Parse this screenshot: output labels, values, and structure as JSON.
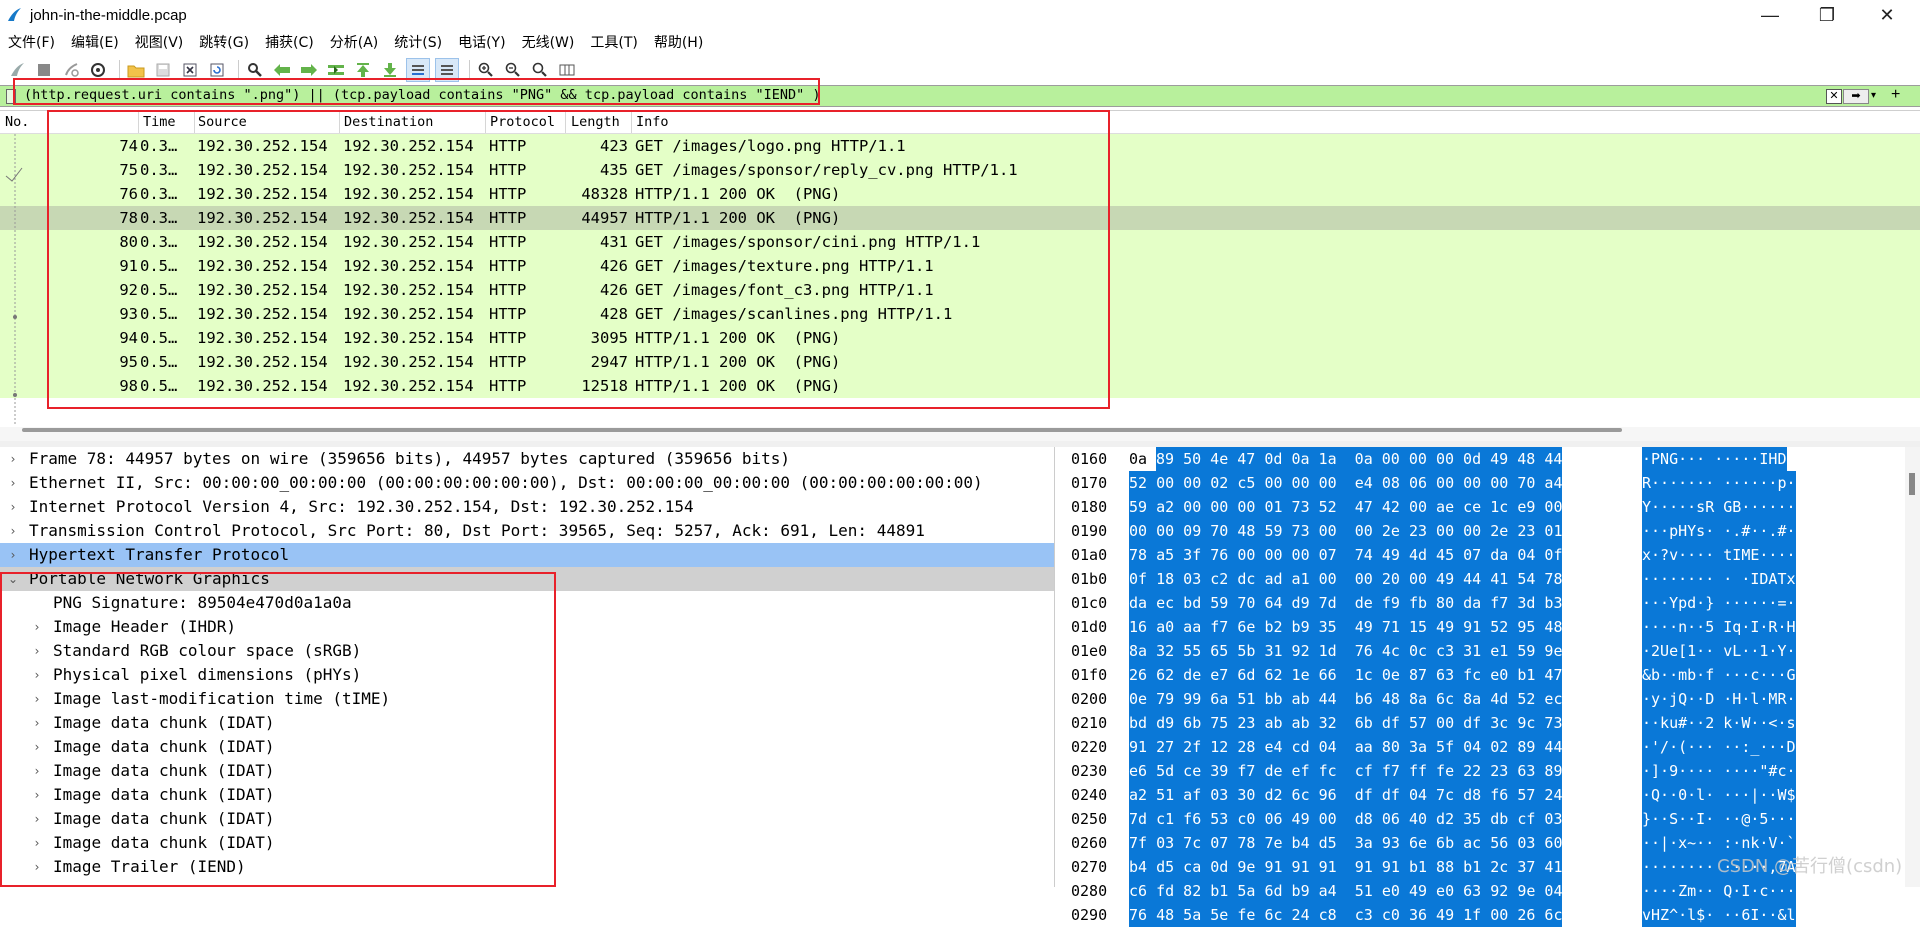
{
  "window": {
    "title": "john-in-the-middle.pcap",
    "minimize": "—",
    "maximize": "❐",
    "close": "✕"
  },
  "menu": [
    "文件(F)",
    "编辑(E)",
    "视图(V)",
    "跳转(G)",
    "捕获(C)",
    "分析(A)",
    "统计(S)",
    "电话(Y)",
    "无线(W)",
    "工具(T)",
    "帮助(H)"
  ],
  "toolbar_icons": [
    "shark-fin-start-icon",
    "stop-icon",
    "restart-icon",
    "capture-options-icon",
    "open-folder-icon",
    "save-icon",
    "close-file-icon",
    "reload-icon",
    "find-icon",
    "back-arrow-icon",
    "forward-arrow-icon",
    "goto-packet-icon",
    "first-packet-icon",
    "last-packet-icon",
    "autoscroll-icon",
    "colorize-icon",
    "zoom-in-icon",
    "zoom-out-icon",
    "zoom-normal-icon",
    "resize-columns-icon"
  ],
  "filter": {
    "text": "(http.request.uri contains \".png\") || (tcp.payload contains \"PNG\" && tcp.payload contains \"IEND\" )",
    "clear_label": "✕",
    "apply_label": "➡",
    "dropdown_label": "▾",
    "add_label": "+",
    "bg_color": "#b8f09c"
  },
  "packet_list": {
    "columns": [
      "No.",
      "Time",
      "Source",
      "Destination",
      "Protocol",
      "Length",
      "Info"
    ],
    "rows": [
      {
        "no": "74",
        "time": "0.3…",
        "src": "192.30.252.154",
        "dst": "192.30.252.154",
        "proto": "HTTP",
        "len": "423",
        "info": "GET /images/logo.png HTTP/1.1"
      },
      {
        "no": "75",
        "time": "0.3…",
        "src": "192.30.252.154",
        "dst": "192.30.252.154",
        "proto": "HTTP",
        "len": "435",
        "info": "GET /images/sponsor/reply_cv.png HTTP/1.1"
      },
      {
        "no": "76",
        "time": "0.3…",
        "src": "192.30.252.154",
        "dst": "192.30.252.154",
        "proto": "HTTP",
        "len": "48328",
        "info": "HTTP/1.1 200 OK  (PNG)"
      },
      {
        "no": "78",
        "time": "0.3…",
        "src": "192.30.252.154",
        "dst": "192.30.252.154",
        "proto": "HTTP",
        "len": "44957",
        "info": "HTTP/1.1 200 OK  (PNG)",
        "selected": true
      },
      {
        "no": "80",
        "time": "0.3…",
        "src": "192.30.252.154",
        "dst": "192.30.252.154",
        "proto": "HTTP",
        "len": "431",
        "info": "GET /images/sponsor/cini.png HTTP/1.1"
      },
      {
        "no": "91",
        "time": "0.5…",
        "src": "192.30.252.154",
        "dst": "192.30.252.154",
        "proto": "HTTP",
        "len": "426",
        "info": "GET /images/texture.png HTTP/1.1"
      },
      {
        "no": "92",
        "time": "0.5…",
        "src": "192.30.252.154",
        "dst": "192.30.252.154",
        "proto": "HTTP",
        "len": "426",
        "info": "GET /images/font_c3.png HTTP/1.1"
      },
      {
        "no": "93",
        "time": "0.5…",
        "src": "192.30.252.154",
        "dst": "192.30.252.154",
        "proto": "HTTP",
        "len": "428",
        "info": "GET /images/scanlines.png HTTP/1.1"
      },
      {
        "no": "94",
        "time": "0.5…",
        "src": "192.30.252.154",
        "dst": "192.30.252.154",
        "proto": "HTTP",
        "len": "3095",
        "info": "HTTP/1.1 200 OK  (PNG)"
      },
      {
        "no": "95",
        "time": "0.5…",
        "src": "192.30.252.154",
        "dst": "192.30.252.154",
        "proto": "HTTP",
        "len": "2947",
        "info": "HTTP/1.1 200 OK  (PNG)"
      },
      {
        "no": "98",
        "time": "0.5…",
        "src": "192.30.252.154",
        "dst": "192.30.252.154",
        "proto": "HTTP",
        "len": "12518",
        "info": "HTTP/1.1 200 OK  (PNG)"
      }
    ]
  },
  "detail": [
    {
      "text": "Frame 78: 44957 bytes on wire (359656 bits), 44957 bytes captured (359656 bits)",
      "level": 0,
      "arrow": "›",
      "style": ""
    },
    {
      "text": "Ethernet II, Src: 00:00:00_00:00:00 (00:00:00:00:00:00), Dst: 00:00:00_00:00:00 (00:00:00:00:00:00)",
      "level": 0,
      "arrow": "›",
      "style": ""
    },
    {
      "text": "Internet Protocol Version 4, Src: 192.30.252.154, Dst: 192.30.252.154",
      "level": 0,
      "arrow": "›",
      "style": ""
    },
    {
      "text": "Transmission Control Protocol, Src Port: 80, Dst Port: 39565, Seq: 5257, Ack: 691, Len: 44891",
      "level": 0,
      "arrow": "›",
      "style": ""
    },
    {
      "text": "Hypertext Transfer Protocol",
      "level": 0,
      "arrow": "›",
      "style": "hl"
    },
    {
      "text": "Portable Network Graphics",
      "level": 0,
      "arrow": "⌄",
      "style": "sel"
    },
    {
      "text": "PNG Signature: 89504e470d0a1a0a",
      "level": 1,
      "arrow": "",
      "style": ""
    },
    {
      "text": "Image Header (IHDR)",
      "level": 1,
      "arrow": "›",
      "style": ""
    },
    {
      "text": "Standard RGB colour space (sRGB)",
      "level": 1,
      "arrow": "›",
      "style": ""
    },
    {
      "text": "Physical pixel dimensions (pHYs)",
      "level": 1,
      "arrow": "›",
      "style": ""
    },
    {
      "text": "Image last-modification time (tIME)",
      "level": 1,
      "arrow": "›",
      "style": ""
    },
    {
      "text": "Image data chunk (IDAT)",
      "level": 1,
      "arrow": "›",
      "style": ""
    },
    {
      "text": "Image data chunk (IDAT)",
      "level": 1,
      "arrow": "›",
      "style": ""
    },
    {
      "text": "Image data chunk (IDAT)",
      "level": 1,
      "arrow": "›",
      "style": ""
    },
    {
      "text": "Image data chunk (IDAT)",
      "level": 1,
      "arrow": "›",
      "style": ""
    },
    {
      "text": "Image data chunk (IDAT)",
      "level": 1,
      "arrow": "›",
      "style": ""
    },
    {
      "text": "Image data chunk (IDAT)",
      "level": 1,
      "arrow": "›",
      "style": ""
    },
    {
      "text": "Image Trailer (IEND)",
      "level": 1,
      "arrow": "›",
      "style": ""
    }
  ],
  "bytes": [
    {
      "offset": "0160",
      "first": "0a",
      "hex": "89 50 4e 47 0d 0a 1a  0a 00 00 00 0d 49 48 44",
      "ascii": "·PNG··· ·····IHD"
    },
    {
      "offset": "0170",
      "first": "",
      "hex": "52 00 00 02 c5 00 00 00  e4 08 06 00 00 00 70 a4",
      "ascii": "R······· ······p·"
    },
    {
      "offset": "0180",
      "first": "",
      "hex": "59 a2 00 00 00 01 73 52  47 42 00 ae ce 1c e9 00",
      "ascii": "Y·····sR GB······"
    },
    {
      "offset": "0190",
      "first": "",
      "hex": "00 00 09 70 48 59 73 00  00 2e 23 00 00 2e 23 01",
      "ascii": "···pHYs· ·.#··.#·"
    },
    {
      "offset": "01a0",
      "first": "",
      "hex": "78 a5 3f 76 00 00 00 07  74 49 4d 45 07 da 04 0f",
      "ascii": "x·?v···· tIME····"
    },
    {
      "offset": "01b0",
      "first": "",
      "hex": "0f 18 03 c2 dc ad a1 00  00 20 00 49 44 41 54 78",
      "ascii": "········ · ·IDATx"
    },
    {
      "offset": "01c0",
      "first": "",
      "hex": "da ec bd 59 70 64 d9 7d  de f9 fb 80 da f7 3d b3",
      "ascii": "···Ypd·} ······=·"
    },
    {
      "offset": "01d0",
      "first": "",
      "hex": "16 a0 aa f7 6e b2 b9 35  49 71 15 49 91 52 95 48",
      "ascii": "····n··5 Iq·I·R·H"
    },
    {
      "offset": "01e0",
      "first": "",
      "hex": "8a 32 55 65 5b 31 92 1d  76 4c 0c c3 31 e1 59 9e",
      "ascii": "·2Ue[1·· vL··1·Y·"
    },
    {
      "offset": "01f0",
      "first": "",
      "hex": "26 62 de e7 6d 62 1e 66  1c 0e 87 63 fc e0 b1 47",
      "ascii": "&b··mb·f ···c···G"
    },
    {
      "offset": "0200",
      "first": "",
      "hex": "0e 79 99 6a 51 bb ab 44  b6 48 8a 6c 8a 4d 52 ec",
      "ascii": "·y·jQ··D ·H·l·MR·"
    },
    {
      "offset": "0210",
      "first": "",
      "hex": "bd d9 6b 75 23 ab ab 32  6b df 57 00 df 3c 9c 73",
      "ascii": "··ku#··2 k·W··<·s"
    },
    {
      "offset": "0220",
      "first": "",
      "hex": "91 27 2f 12 28 e4 cd 04  aa 80 3a 5f 04 02 89 44",
      "ascii": "·'/·(··· ··:_···D"
    },
    {
      "offset": "0230",
      "first": "",
      "hex": "e6 5d ce 39 f7 de ef fc  cf f7 ff fe 22 23 63 89",
      "ascii": "·]·9···· ····\"#c·"
    },
    {
      "offset": "0240",
      "first": "",
      "hex": "a2 51 af 03 30 d2 6c 96  df df 04 7c d8 f6 57 24",
      "ascii": "·Q··0·l· ···|··W$"
    },
    {
      "offset": "0250",
      "first": "",
      "hex": "7d c1 f6 53 c0 06 49 00  d8 06 40 d2 35 db cf 03",
      "ascii": "}··S··I· ··@·5···"
    },
    {
      "offset": "0260",
      "first": "",
      "hex": "7f 03 7c 07 78 7e b4 d5  3a 93 6e 6b ac 56 03 60",
      "ascii": "··|·x~·· :·nk·V·`"
    },
    {
      "offset": "0270",
      "first": "",
      "hex": "b4 d5 ca 0d 9e 91 91 91  91 91 b1 88 b1 2c 37 41",
      "ascii": "········ ·····,7A"
    },
    {
      "offset": "0280",
      "first": "",
      "hex": "c6 fd 82 b1 5a 6d b9 a4  51 e0 49 e0 63 92 9e 04",
      "ascii": "····Zm·· Q·I·c···"
    },
    {
      "offset": "0290",
      "first": "",
      "hex": "76 48 5a 5e fe 6c 24 c8  c3 c0 36 49 1f 00 26 6c",
      "ascii": "vHZ^·l$· ··6I··&l"
    }
  ],
  "watermark": "CSDN @苦行僧(csdn)",
  "colors": {
    "row_bg": "#e4ffc7",
    "row_selected": "#c7d8b4",
    "hl_blue": "#99c3f5",
    "byte_sel": "#0a78d7",
    "annotation_red": "#e8212a"
  }
}
